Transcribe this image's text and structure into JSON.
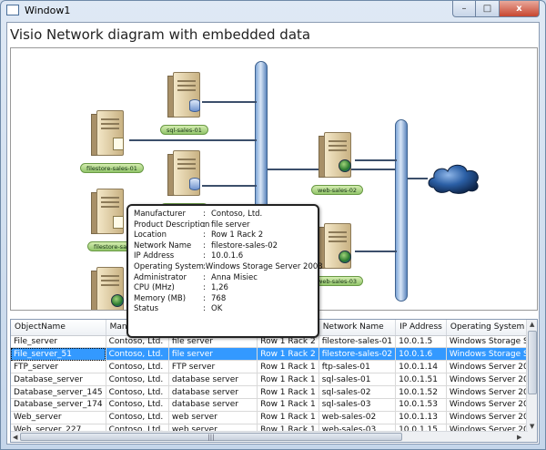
{
  "window": {
    "title": "Window1",
    "buttons": {
      "minimize": "–",
      "maximize": "□",
      "close": "x"
    }
  },
  "heading": "Visio Network diagram with embedded data",
  "diagram": {
    "labels": {
      "sql1": "sql-sales-01",
      "sql2": "sql-sales-02",
      "fs1": "filestore-sales-01",
      "fs2": "filestore-sales-02",
      "ftp": "ftp-sales-01",
      "web2": "web-sales-02",
      "web3": "web-sales-03"
    },
    "tooltip": [
      {
        "key": "Manufacturer",
        "value": "Contoso, Ltd."
      },
      {
        "key": "Product Description",
        "value": "file server"
      },
      {
        "key": "Location",
        "value": "Row 1 Rack 2"
      },
      {
        "key": "Network Name",
        "value": "filestore-sales-02"
      },
      {
        "key": "IP Address",
        "value": "10.0.1.6"
      },
      {
        "key": "Operating System",
        "value": "Windows Storage Server 2003"
      },
      {
        "key": "Administrator",
        "value": "Anna Misiec"
      },
      {
        "key": "CPU (MHz)",
        "value": "1,26"
      },
      {
        "key": "Memory (MB)",
        "value": "768"
      },
      {
        "key": "Status",
        "value": "OK"
      }
    ]
  },
  "grid": {
    "columns": [
      "ObjectName",
      "Manufacturer",
      "Product Description",
      "Location",
      "Network Name",
      "IP Address",
      "Operating System"
    ],
    "selected_row": 1,
    "rows": [
      [
        "File_server",
        "Contoso, Ltd.",
        "file server",
        "Row 1 Rack 2",
        "filestore-sales-01",
        "10.0.1.5",
        "Windows Storage Server 2003"
      ],
      [
        "File_server_51",
        "Contoso, Ltd.",
        "file server",
        "Row 1 Rack 2",
        "filestore-sales-02",
        "10.0.1.6",
        "Windows Storage Server 2003"
      ],
      [
        "FTP_server",
        "Contoso, Ltd.",
        "FTP server",
        "Row 1 Rack 1",
        "ftp-sales-01",
        "10.0.1.14",
        "Windows Server 2003, Standard Edition"
      ],
      [
        "Database_server",
        "Contoso, Ltd.",
        "database server",
        "Row 1 Rack 1",
        "sql-sales-01",
        "10.0.1.51",
        "Windows Server 2003, Datacenter Edition"
      ],
      [
        "Database_server_145",
        "Contoso, Ltd.",
        "database server",
        "Row 1 Rack 1",
        "sql-sales-02",
        "10.0.1.52",
        "Windows Server 2003, Datacenter Edition"
      ],
      [
        "Database_server_174",
        "Contoso, Ltd.",
        "database server",
        "Row 1 Rack 1",
        "sql-sales-03",
        "10.0.1.53",
        "Windows Server 2003, Datacenter Edition"
      ],
      [
        "Web_server",
        "Contoso, Ltd.",
        "web server",
        "Row 1 Rack 1",
        "web-sales-02",
        "10.0.1.13",
        "Windows Server 2003, Web Edition"
      ],
      [
        "Web_server_227",
        "Contoso, Ltd.",
        "web server",
        "Row 1 Rack 1",
        "web-sales-03",
        "10.0.1.15",
        "Windows Server 2003, Web Edition"
      ]
    ],
    "hscroll_grip": "|||"
  }
}
